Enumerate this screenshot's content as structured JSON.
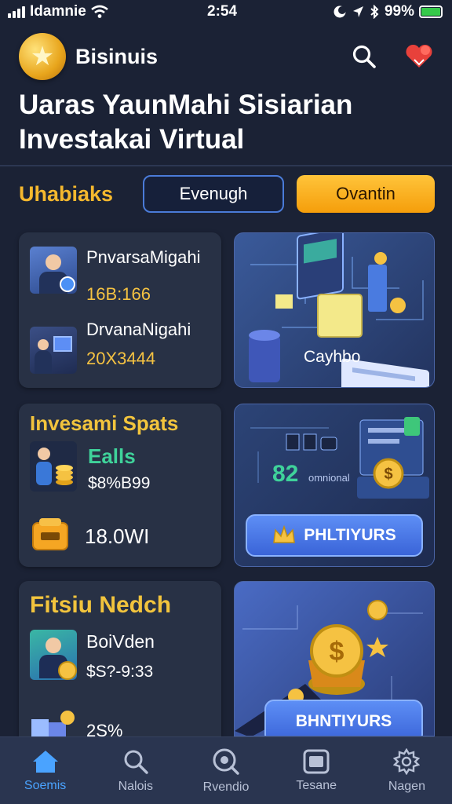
{
  "status_bar": {
    "carrier": "Idamnie",
    "time": "2:54",
    "battery": "99%"
  },
  "header": {
    "brand": "Bisinuis",
    "icons": [
      "search-icon",
      "heart-icon"
    ]
  },
  "hero": {
    "title_line1": "Uaras YaunMahi Sisiarian",
    "title_line2": "Investakai Virtual"
  },
  "filter": {
    "label": "Uhabiaks",
    "outline_button": "Evenugh",
    "solid_button": "Ovantin"
  },
  "card1": {
    "items": [
      {
        "name": "PnvarsaMigahi",
        "value": "16B:166"
      },
      {
        "name": "DrvanaNigahi",
        "value": "20X3444"
      }
    ]
  },
  "illus1": {
    "label": "Cayhbo"
  },
  "card2": {
    "title": "Invesami Spats",
    "green_value": "Ealls",
    "price": "$8%B99",
    "amount": "18.0WI"
  },
  "illus2": {
    "number": "82",
    "small_text": "omnional",
    "button": "PHLTIYURS"
  },
  "card3": {
    "title": "Fitsiu Nedch",
    "name": "BoiVden",
    "price": "$S?-9:33",
    "partial": "2S%"
  },
  "illus3": {
    "button": "BHNTIYURS"
  },
  "nav": {
    "items": [
      {
        "label": "Soemis",
        "icon": "home-icon"
      },
      {
        "label": "Nalois",
        "icon": "search-icon"
      },
      {
        "label": "Rvendio",
        "icon": "search-circle-icon"
      },
      {
        "label": "Tesane",
        "icon": "window-icon"
      },
      {
        "label": "Nagen",
        "icon": "gear-icon"
      }
    ]
  },
  "colors": {
    "background": "#1b2235",
    "accent_gold": "#f5b82e",
    "accent_blue": "#4aa3ff",
    "green": "#3fd29a"
  }
}
